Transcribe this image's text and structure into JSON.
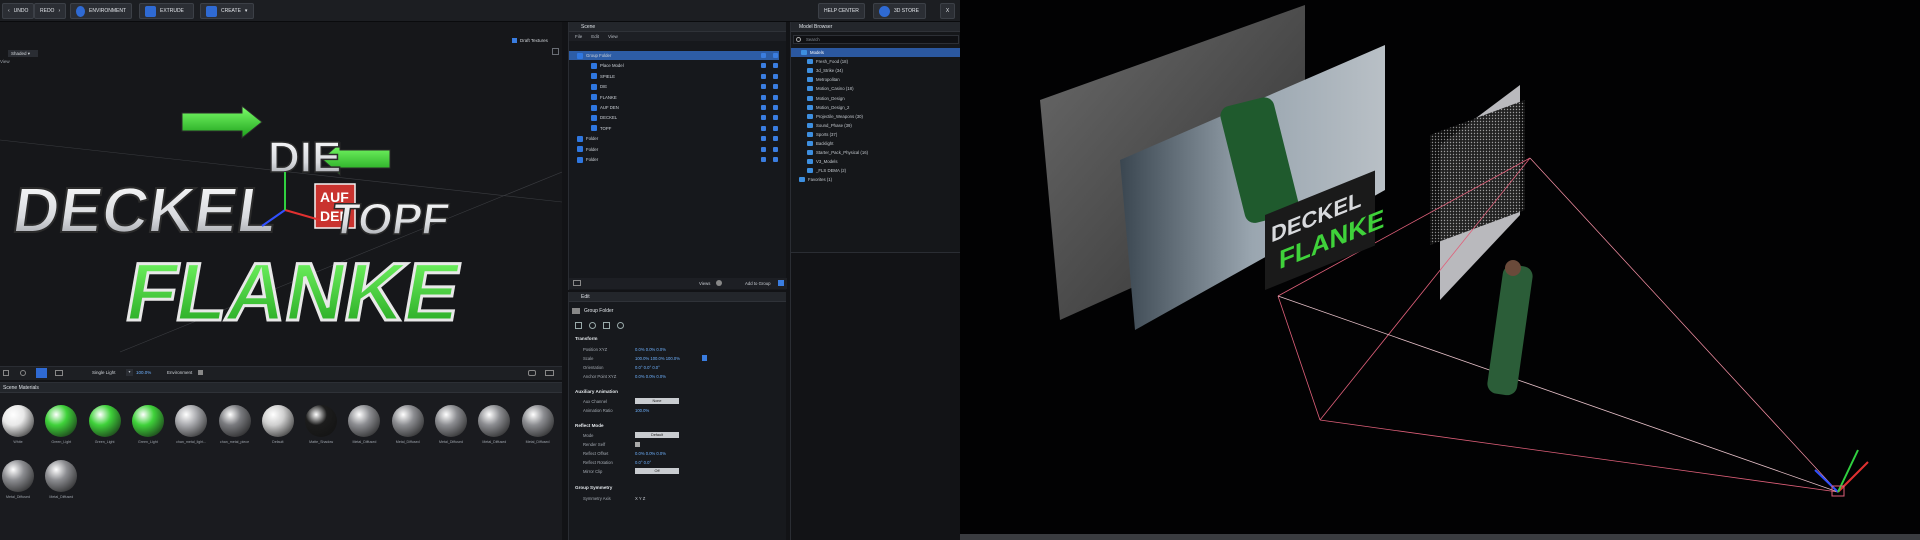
{
  "toolbar": {
    "undo": "UNDO",
    "redo": "REDO",
    "environment": "ENVIRONMENT",
    "extrude": "EXTRUDE",
    "create": "CREATE",
    "help_center": "HELP CENTER",
    "store": "3D STORE",
    "close": "X"
  },
  "viewport": {
    "view_dropdown": "Shaded",
    "view_label": "View",
    "draft_textures": "Draft Textures",
    "logo_lines": [
      "DIE",
      "DECKEL",
      "AUF",
      "DEN",
      "TOPF",
      "FLANKE"
    ],
    "light_label": "Single Light",
    "light_value": "100.0%",
    "environment_label": "Environment"
  },
  "materials": {
    "title": "Scene Materials",
    "items": [
      {
        "label": "White",
        "color": "#e8e8e8"
      },
      {
        "label": "Green_Light",
        "color": "#3fd23a"
      },
      {
        "label": "Green_Light",
        "color": "#3fd23a"
      },
      {
        "label": "Green_Light",
        "color": "#3fd23a"
      },
      {
        "label": "chan_metal_light...",
        "color": "#a9aaae"
      },
      {
        "label": "chan_metal_piece",
        "color": "#7a7b7f"
      },
      {
        "label": "Default",
        "color": "#cfcfcf"
      },
      {
        "label": "Matte_Shadow",
        "color": "#1c1c1c"
      },
      {
        "label": "Metal_Diffused",
        "color": "#8c8d91"
      },
      {
        "label": "Metal_Diffused",
        "color": "#8c8d91"
      },
      {
        "label": "Metal_Diffused",
        "color": "#8c8d91"
      },
      {
        "label": "Metal_Diffused",
        "color": "#8c8d91"
      },
      {
        "label": "Metal_Diffused",
        "color": "#8c8d91"
      },
      {
        "label": "Metal_Diffused",
        "color": "#8c8d91"
      },
      {
        "label": "Metal_Diffused",
        "color": "#8c8d91"
      }
    ]
  },
  "scene": {
    "title": "Scene",
    "menu": [
      "File",
      "Edit",
      "View"
    ],
    "rows": [
      {
        "label": "Group Folder",
        "selected": true
      },
      {
        "label": "Place Model"
      },
      {
        "label": "SPIELE"
      },
      {
        "label": "DIE"
      },
      {
        "label": "FLANKE"
      },
      {
        "label": "AUF DEN"
      },
      {
        "label": "DECKEL"
      },
      {
        "label": "TOPF"
      },
      {
        "label": "Folder"
      },
      {
        "label": "Folder"
      },
      {
        "label": "Folder"
      }
    ],
    "views_label": "Views",
    "add_to_group": "Add to Group"
  },
  "edit": {
    "title": "Edit",
    "subtitle": "Group Folder",
    "transform": "Transform",
    "position_label": "Position XYZ",
    "position_value": "0.0%  0.0%  0.0%",
    "scale_label": "Scale",
    "scale_value": "100.0%  100.0%  100.0%",
    "orientation_label": "Orientation",
    "orientation_value": "0.0°  0.0°  0.0°",
    "anchor_label": "Anchor Point XYZ",
    "anchor_value": "0.0%  0.0%  0.0%",
    "aux": "Auxiliary Animation",
    "aux_channel_label": "Aux Channel",
    "aux_channel_value": "None",
    "anim_ratio_label": "Animation Ratio",
    "anim_ratio_value": "100.0%",
    "reflect": "Reflect Mode",
    "mode_label": "Mode",
    "mode_value": "Default",
    "render_self_label": "Render Self",
    "reflect_offset_label": "Reflect Offset",
    "reflect_offset_value": "0.0%  0.0%  0.0%",
    "reflect_rot_label": "Reflect Rotation",
    "reflect_rot_value": "0.0°  0.0°",
    "mirror_clip_label": "Mirror Clip",
    "mirror_clip_value": "Off",
    "symmetry": "Group Symmetry",
    "symmetry_axis_label": "Symmetry Axis",
    "symmetry_axis_value": "X  Y  Z"
  },
  "model_browser": {
    "title": "Model Browser",
    "search_placeholder": "Search",
    "rows": [
      {
        "label": "Models",
        "selected": true
      },
      {
        "label": "Fresh_Food (18)"
      },
      {
        "label": "3d_Strike (34)"
      },
      {
        "label": "Metropolitan"
      },
      {
        "label": "Motion_Casino (18)"
      },
      {
        "label": "Motion_Design"
      },
      {
        "label": "Motion_Design_2"
      },
      {
        "label": "Projectile_Weapons (30)"
      },
      {
        "label": "Sound_Phase (39)"
      },
      {
        "label": "Sports (37)"
      },
      {
        "label": "Backlight"
      },
      {
        "label": "Starter_Pack_Physical (16)"
      },
      {
        "label": "V3_Models"
      },
      {
        "label": "_FLS DEMA (2)"
      },
      {
        "label": "Favorites (1)"
      }
    ]
  },
  "colors": {
    "accent": "#2f6ad3",
    "green": "#3fd23a",
    "frustum": "#e0607a"
  }
}
